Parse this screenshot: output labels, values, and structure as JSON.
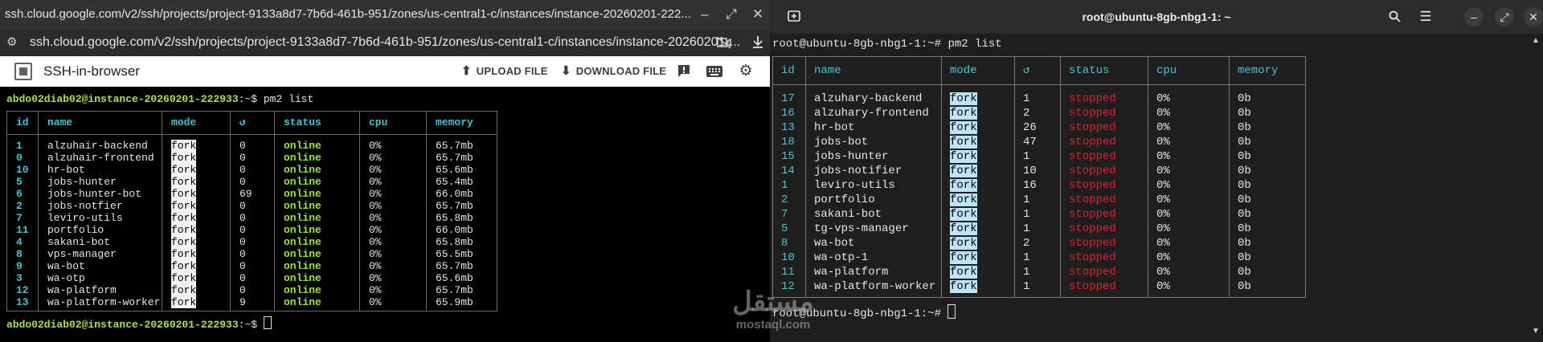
{
  "left": {
    "window_title": "ssh.cloud.google.com/v2/ssh/projects/project-9133a8d7-7b6d-461b-951/zones/us-central1-c/instances/instance-20260201-222...",
    "window_controls": {
      "minimize": "–",
      "maximize": "⤢",
      "close": "✕"
    },
    "url": "ssh.cloud.google.com/v2/ssh/projects/project-9133a8d7-7b6d-461b-951/zones/us-central1-c/instances/instance-20260201-...",
    "app_name": "SSH-in-browser",
    "upload_label": "UPLOAD FILE",
    "download_label": "DOWNLOAD FILE",
    "prompt_user": "abdo02diab02@instance-20260201-222933",
    "prompt_suffix": ":~$ ",
    "command": "pm2 list",
    "table": {
      "headers": [
        "id",
        "name",
        "mode",
        "↺",
        "status",
        "cpu",
        "memory"
      ],
      "rows": [
        {
          "id": "1",
          "name": "alzuhair-backend",
          "mode": "fork",
          "restarts": "0",
          "status": "online",
          "cpu": "0%",
          "memory": "65.7mb"
        },
        {
          "id": "0",
          "name": "alzuhair-frontend",
          "mode": "fork",
          "restarts": "0",
          "status": "online",
          "cpu": "0%",
          "memory": "65.7mb"
        },
        {
          "id": "10",
          "name": "hr-bot",
          "mode": "fork",
          "restarts": "0",
          "status": "online",
          "cpu": "0%",
          "memory": "65.6mb"
        },
        {
          "id": "5",
          "name": "jobs-hunter",
          "mode": "fork",
          "restarts": "0",
          "status": "online",
          "cpu": "0%",
          "memory": "65.4mb"
        },
        {
          "id": "6",
          "name": "jobs-hunter-bot",
          "mode": "fork",
          "restarts": "69",
          "status": "online",
          "cpu": "0%",
          "memory": "66.0mb"
        },
        {
          "id": "2",
          "name": "jobs-notfier",
          "mode": "fork",
          "restarts": "0",
          "status": "online",
          "cpu": "0%",
          "memory": "65.7mb"
        },
        {
          "id": "7",
          "name": "leviro-utils",
          "mode": "fork",
          "restarts": "0",
          "status": "online",
          "cpu": "0%",
          "memory": "65.8mb"
        },
        {
          "id": "11",
          "name": "portfolio",
          "mode": "fork",
          "restarts": "0",
          "status": "online",
          "cpu": "0%",
          "memory": "66.0mb"
        },
        {
          "id": "4",
          "name": "sakani-bot",
          "mode": "fork",
          "restarts": "0",
          "status": "online",
          "cpu": "0%",
          "memory": "65.8mb"
        },
        {
          "id": "8",
          "name": "vps-manager",
          "mode": "fork",
          "restarts": "0",
          "status": "online",
          "cpu": "0%",
          "memory": "65.5mb"
        },
        {
          "id": "9",
          "name": "wa-bot",
          "mode": "fork",
          "restarts": "0",
          "status": "online",
          "cpu": "0%",
          "memory": "65.7mb"
        },
        {
          "id": "3",
          "name": "wa-otp",
          "mode": "fork",
          "restarts": "0",
          "status": "online",
          "cpu": "0%",
          "memory": "65.6mb"
        },
        {
          "id": "12",
          "name": "wa-platform",
          "mode": "fork",
          "restarts": "0",
          "status": "online",
          "cpu": "0%",
          "memory": "65.7mb"
        },
        {
          "id": "13",
          "name": "wa-platform-worker",
          "mode": "fork",
          "restarts": "9",
          "status": "online",
          "cpu": "0%",
          "memory": "65.9mb"
        }
      ]
    }
  },
  "right": {
    "window_title": "root@ubuntu-8gb-nbg1-1: ~",
    "prompt": "root@ubuntu-8gb-nbg1-1:~# ",
    "command": "pm2 list",
    "table": {
      "headers": [
        "id",
        "name",
        "mode",
        "↺",
        "status",
        "cpu",
        "memory"
      ],
      "rows": [
        {
          "id": "17",
          "name": "alzuhary-backend",
          "mode": "fork",
          "restarts": "1",
          "status": "stopped",
          "cpu": "0%",
          "memory": "0b"
        },
        {
          "id": "16",
          "name": "alzuhary-frontend",
          "mode": "fork",
          "restarts": "2",
          "status": "stopped",
          "cpu": "0%",
          "memory": "0b"
        },
        {
          "id": "13",
          "name": "hr-bot",
          "mode": "fork",
          "restarts": "26",
          "status": "stopped",
          "cpu": "0%",
          "memory": "0b"
        },
        {
          "id": "18",
          "name": "jobs-bot",
          "mode": "fork",
          "restarts": "47",
          "status": "stopped",
          "cpu": "0%",
          "memory": "0b"
        },
        {
          "id": "15",
          "name": "jobs-hunter",
          "mode": "fork",
          "restarts": "1",
          "status": "stopped",
          "cpu": "0%",
          "memory": "0b"
        },
        {
          "id": "14",
          "name": "jobs-notifier",
          "mode": "fork",
          "restarts": "10",
          "status": "stopped",
          "cpu": "0%",
          "memory": "0b"
        },
        {
          "id": "1",
          "name": "leviro-utils",
          "mode": "fork",
          "restarts": "16",
          "status": "stopped",
          "cpu": "0%",
          "memory": "0b"
        },
        {
          "id": "2",
          "name": "portfolio",
          "mode": "fork",
          "restarts": "1",
          "status": "stopped",
          "cpu": "0%",
          "memory": "0b"
        },
        {
          "id": "7",
          "name": "sakani-bot",
          "mode": "fork",
          "restarts": "1",
          "status": "stopped",
          "cpu": "0%",
          "memory": "0b"
        },
        {
          "id": "5",
          "name": "tg-vps-manager",
          "mode": "fork",
          "restarts": "1",
          "status": "stopped",
          "cpu": "0%",
          "memory": "0b"
        },
        {
          "id": "8",
          "name": "wa-bot",
          "mode": "fork",
          "restarts": "2",
          "status": "stopped",
          "cpu": "0%",
          "memory": "0b"
        },
        {
          "id": "10",
          "name": "wa-otp-1",
          "mode": "fork",
          "restarts": "1",
          "status": "stopped",
          "cpu": "0%",
          "memory": "0b"
        },
        {
          "id": "11",
          "name": "wa-platform",
          "mode": "fork",
          "restarts": "1",
          "status": "stopped",
          "cpu": "0%",
          "memory": "0b"
        },
        {
          "id": "12",
          "name": "wa-platform-worker",
          "mode": "fork",
          "restarts": "1",
          "status": "stopped",
          "cpu": "0%",
          "memory": "0b"
        }
      ]
    }
  },
  "watermark": {
    "arabic": "مستقل",
    "latin": "mostaql.com"
  }
}
